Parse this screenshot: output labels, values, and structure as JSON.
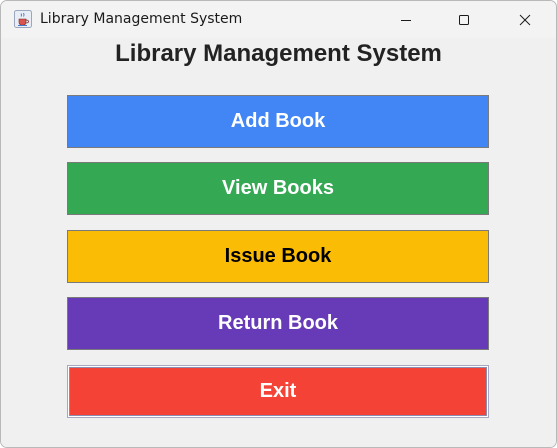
{
  "window": {
    "title": "Library Management System",
    "app_icon": "java-cup-icon",
    "controls": {
      "minimize_icon": "minimize-icon",
      "maximize_icon": "maximize-icon",
      "close_icon": "close-icon"
    }
  },
  "main": {
    "heading": "Library Management System",
    "buttons": [
      {
        "label": "Add Book",
        "bg": "#4285f4",
        "fg": "#ffffff"
      },
      {
        "label": "View Books",
        "bg": "#34a853",
        "fg": "#ffffff"
      },
      {
        "label": "Issue Book",
        "bg": "#fbbc05",
        "fg": "#000000"
      },
      {
        "label": "Return Book",
        "bg": "#673ab7",
        "fg": "#ffffff"
      },
      {
        "label": "Exit",
        "bg": "#f44336",
        "fg": "#ffffff"
      }
    ]
  }
}
